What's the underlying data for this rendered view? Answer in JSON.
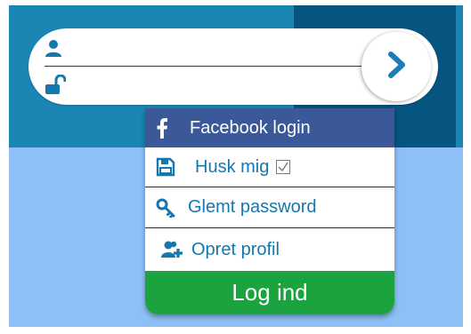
{
  "login": {
    "username": {
      "icon": "user-icon",
      "value": ""
    },
    "password": {
      "icon": "unlock-icon",
      "value": ""
    },
    "submit": {
      "icon": "chevron-right-icon"
    }
  },
  "menu": {
    "facebook": {
      "icon": "facebook-icon",
      "label": "Facebook login"
    },
    "remember": {
      "icon": "floppy-disk-icon",
      "label": "Husk mig",
      "checked": true
    },
    "forgot": {
      "icon": "key-icon",
      "label": "Glemt password"
    },
    "create": {
      "icon": "add-user-icon",
      "label": "Opret profil"
    },
    "login_button": "Log ind"
  },
  "colors": {
    "top_panel": "#1b86b4",
    "top_panel_dark": "#055580",
    "lower_panel": "#8ec0f7",
    "facebook": "#3b5998",
    "link_blue": "#1577ad",
    "login_green": "#1aa33f"
  }
}
